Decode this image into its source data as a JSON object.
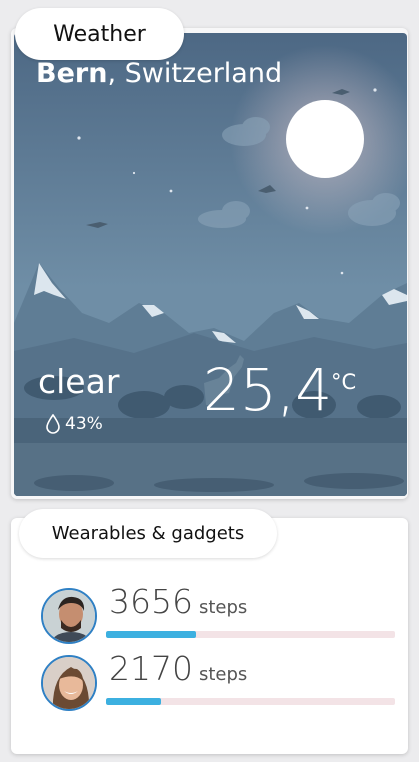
{
  "weather": {
    "tab_label": "Weather",
    "city": "Bern",
    "country": ", Switzerland",
    "condition": "clear",
    "humidity": "43%",
    "temperature": "25,4",
    "unit": "°C"
  },
  "wearables": {
    "tab_label": "Wearables & gadgets",
    "users": [
      {
        "steps": "3656",
        "steps_label": "steps",
        "progress": 0.31
      },
      {
        "steps": "2170",
        "steps_label": "steps",
        "progress": 0.19
      }
    ]
  },
  "colors": {
    "sky_top": "#4e6a86",
    "sky_bottom": "#7e9cb0",
    "progress_fill": "#3cb0e0",
    "progress_track": "#f3e3e6",
    "avatar_ring": "#2f80c4"
  }
}
